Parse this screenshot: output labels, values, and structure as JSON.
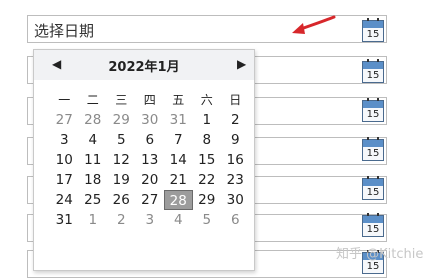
{
  "primary_field": {
    "text": "选择日期"
  },
  "icon_day": "15",
  "calendar": {
    "prev": "◀",
    "next": "▶",
    "month_label": "2022年1月",
    "weekdays": [
      "一",
      "二",
      "三",
      "四",
      "五",
      "六",
      "日"
    ],
    "weeks": [
      [
        "27",
        "28",
        "29",
        "30",
        "31",
        "1",
        "2"
      ],
      [
        "3",
        "4",
        "5",
        "6",
        "7",
        "8",
        "9"
      ],
      [
        "10",
        "11",
        "12",
        "13",
        "14",
        "15",
        "16"
      ],
      [
        "17",
        "18",
        "19",
        "20",
        "21",
        "22",
        "23"
      ],
      [
        "24",
        "25",
        "26",
        "27",
        "28",
        "29",
        "30"
      ],
      [
        "31",
        "1",
        "2",
        "3",
        "4",
        "5",
        "6"
      ]
    ],
    "selected": "28"
  },
  "watermark": "知乎 @Kitchie",
  "colors": {
    "arrow": "#d7272b",
    "selected_bg": "#9c9c9c",
    "icon_cap": "#5b8fc8"
  }
}
